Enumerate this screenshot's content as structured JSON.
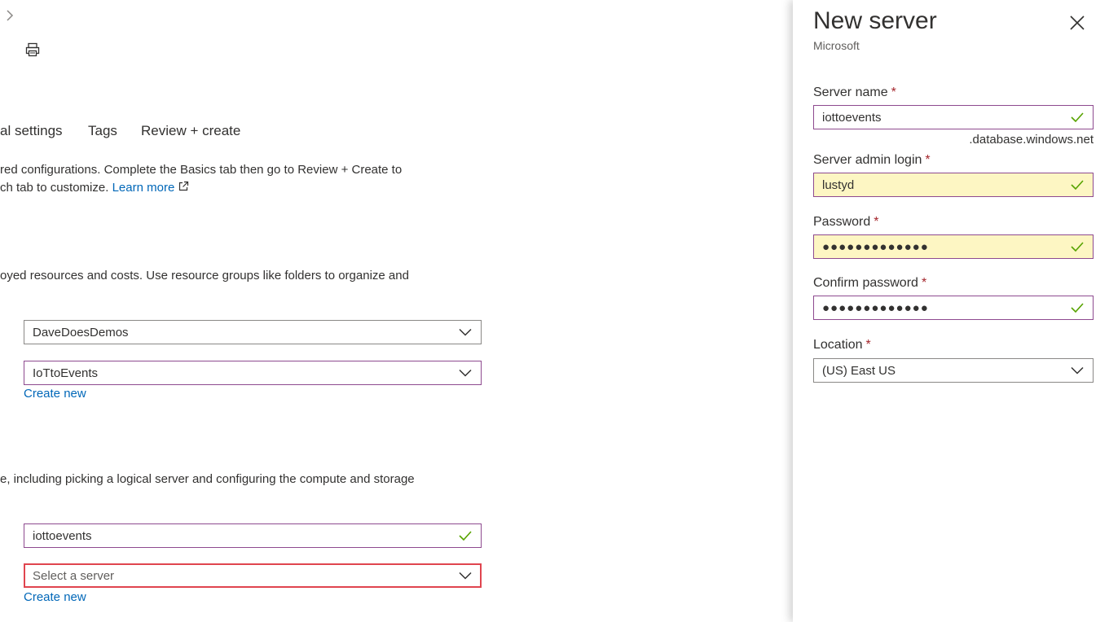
{
  "tabs": [
    {
      "label": "al settings"
    },
    {
      "label": "Tags"
    },
    {
      "label": "Review + create"
    }
  ],
  "intro": {
    "line1": "red configurations. Complete the Basics tab then go to Review + Create to",
    "line2": "ch tab to customize.",
    "learn_more": "Learn more"
  },
  "project": {
    "description": "oyed resources and costs. Use resource groups like folders to organize and",
    "subscription_value": "DaveDoesDemos",
    "resource_group_value": "IoTtoEvents",
    "create_new": "Create new"
  },
  "database": {
    "description": "e, including picking a logical server and configuring the compute and storage",
    "name_value": "iottoevents",
    "server_placeholder": "Select a server",
    "create_new": "Create new"
  },
  "panel": {
    "title": "New server",
    "subtitle": "Microsoft",
    "server_name_label": "Server name",
    "server_name_value": "iottoevents",
    "server_suffix": ".database.windows.net",
    "admin_login_label": "Server admin login",
    "admin_login_value": "lustyd",
    "password_label": "Password",
    "password_value": "●●●●●●●●●●●●●",
    "confirm_password_label": "Confirm password",
    "confirm_password_value": "●●●●●●●●●●●●●",
    "location_label": "Location",
    "location_value": "(US) East US",
    "required_mark": "*"
  },
  "icons": {
    "breadcrumb": "chevron-right-icon",
    "print": "print-icon",
    "external": "external-link-icon",
    "check": "check-icon",
    "dropdown": "chevron-down-icon",
    "close": "close-icon"
  },
  "colors": {
    "link": "#0067b8",
    "valid_check": "#57a300",
    "required": "#a4262c",
    "focus_border": "#8e4a8f",
    "error_border": "#e0454f",
    "autofill_bg": "#fdf6c3"
  }
}
